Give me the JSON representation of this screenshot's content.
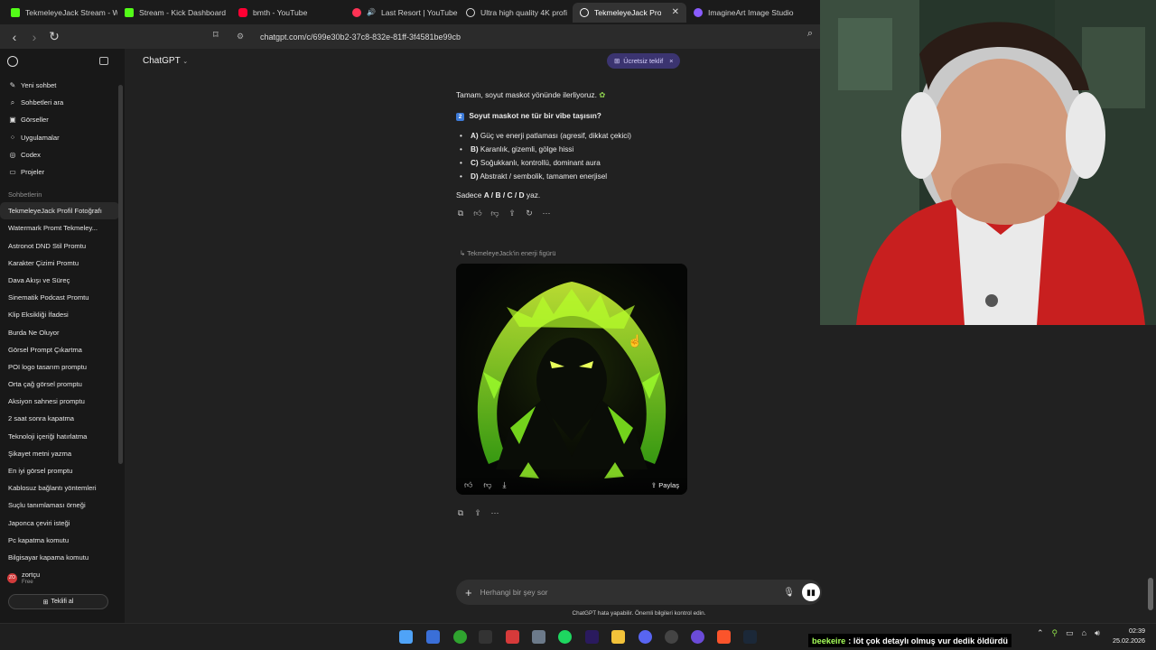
{
  "browser": {
    "tabs": [
      {
        "label": "TekmeleyeJack Stream - W",
        "color": "#53fc18"
      },
      {
        "label": "Stream - Kick Dashboard",
        "color": "#53fc18"
      },
      {
        "label": "bmth - YouTube",
        "color": "#ff0033"
      },
      {
        "label": "Last Resort | YouTube I",
        "color": "#ff3355"
      },
      {
        "label": "Ultra high quality 4K profi",
        "color": "#dddddd"
      },
      {
        "label": "TekmeleyeJack Profil F",
        "color": "#ffffff"
      },
      {
        "label": "ImagineArt Image Studio",
        "color": "#8a5cff"
      }
    ],
    "url": "chatgpt.com/c/699e30b2-37c8-832e-81ff-3f4581be99cb"
  },
  "sidebar": {
    "nav": [
      {
        "icon": "new-chat-icon",
        "label": "Yeni sohbet"
      },
      {
        "icon": "search-icon",
        "label": "Sohbetleri ara"
      },
      {
        "icon": "images-icon",
        "label": "Görseller"
      },
      {
        "icon": "apps-icon",
        "label": "Uygulamalar"
      },
      {
        "icon": "codex-icon",
        "label": "Codex"
      },
      {
        "icon": "folder-icon",
        "label": "Projeler"
      }
    ],
    "section_title": "Sohbetlerin",
    "chats": [
      "TekmeleyeJack Profil Fotoğrafı",
      "Watermark Promt Tekmeley...",
      "Astronot DND Stil Promtu",
      "Karakter Çizimi Promtu",
      "Dava Akışı ve Süreç",
      "Sinematik Podcast Promtu",
      "Klip Eksikliği İfadesi",
      "Burda Ne Oluyor",
      "Görsel Prompt Çıkartma",
      "POI logo tasarım promptu",
      "Orta çağ görsel promptu",
      "Aksiyon sahnesi promptu",
      "2 saat sonra kapatma",
      "Teknoloji içeriği hatırlatma",
      "Şikayet metni yazma",
      "En iyi görsel promptu",
      "Kablosuz bağlantı yöntemleri",
      "Suçlu tanımlaması örneği",
      "Japonca çeviri isteği",
      "Pc kapatma komutu",
      "Bilgisayar kapama komutu"
    ],
    "user": {
      "initials": "ZO",
      "name": "zortçu",
      "plan": "Free"
    },
    "upgrade_label": "Teklifi al"
  },
  "header": {
    "model": "ChatGPT",
    "offer_label": "Ücretsiz teklif"
  },
  "conversation": {
    "intro": "Tamam, soyut maskot yönünde ilerliyoruz.",
    "question": "Soyut maskot ne tür bir vibe taşısın?",
    "options": [
      {
        "key": "A)",
        "text": "Güç ve enerji patlaması (agresif, dikkat çekici)"
      },
      {
        "key": "B)",
        "text": "Karanlık, gizemli, gölge hissi"
      },
      {
        "key": "C)",
        "text": "Soğukkanlı, kontrollü, dominant aura"
      },
      {
        "key": "D)",
        "text": "Abstrakt / sembolik, tamamen enerjisel"
      }
    ],
    "answer_prefix": "Sadece",
    "answer_options": "A / B / C / D",
    "answer_suffix": "yaz.",
    "image_ref_label": "TekmeleyeJack'in enerji figürü",
    "share_label": "Paylaş"
  },
  "composer": {
    "placeholder": "Herhangi bir şey sor",
    "disclaimer": "ChatGPT hata yapabilir. Önemli bilgileri kontrol edin."
  },
  "stream_chat": {
    "user": "beekeire",
    "message": "löt çok detaylı olmuş vur dedik öldürdü"
  },
  "clock": {
    "time": "02:39",
    "date": "25.02.2026"
  }
}
